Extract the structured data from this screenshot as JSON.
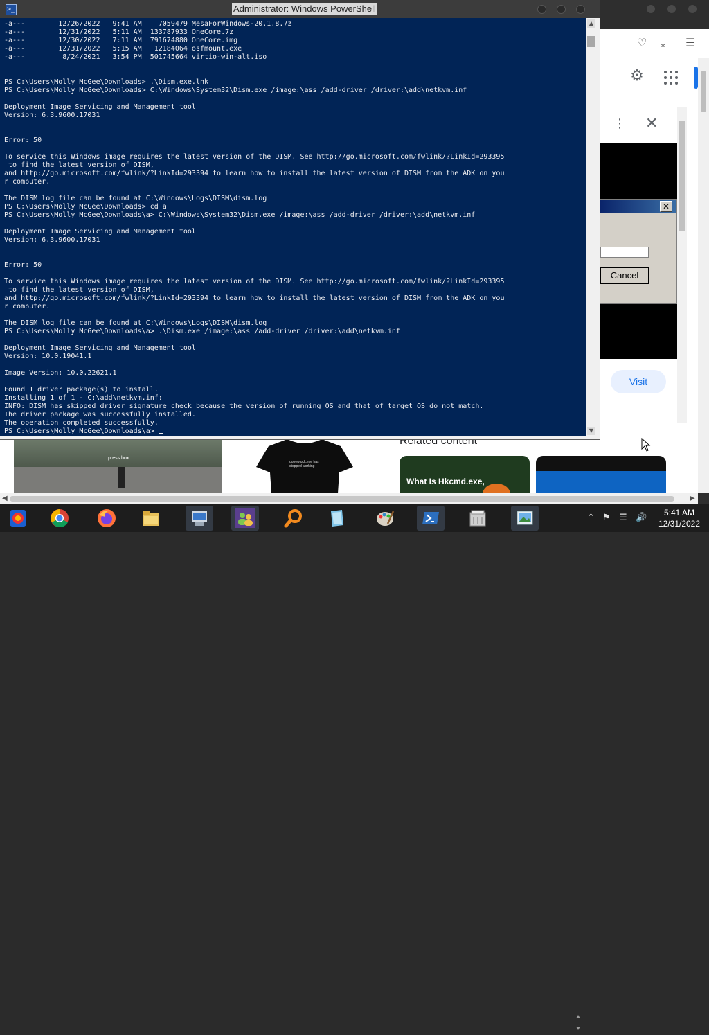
{
  "powershell": {
    "title": "Administrator: Windows PowerShell",
    "icon_glyph": ">_",
    "lines": [
      "-a---        12/26/2022   9:41 AM    7059479 MesaForWindows-20.1.8.7z",
      "-a---        12/31/2022   5:11 AM  133787933 OneCore.7z",
      "-a---        12/30/2022   7:11 AM  791674880 OneCore.img",
      "-a---        12/31/2022   5:15 AM   12184064 osfmount.exe",
      "-a---         8/24/2021   3:54 PM  501745664 virtio-win-alt.iso",
      "",
      "",
      "PS C:\\Users\\Molly McGee\\Downloads> .\\Dism.exe.lnk",
      "PS C:\\Users\\Molly McGee\\Downloads> C:\\Windows\\System32\\Dism.exe /image:\\ass /add-driver /driver:\\add\\netkvm.inf",
      "",
      "Deployment Image Servicing and Management tool",
      "Version: 6.3.9600.17031",
      "",
      "",
      "Error: 50",
      "",
      "To service this Windows image requires the latest version of the DISM. See http://go.microsoft.com/fwlink/?LinkId=293395",
      " to find the latest version of DISM,",
      "and http://go.microsoft.com/fwlink/?LinkId=293394 to learn how to install the latest version of DISM from the ADK on you",
      "r computer.",
      "",
      "The DISM log file can be found at C:\\Windows\\Logs\\DISM\\dism.log",
      "PS C:\\Users\\Molly McGee\\Downloads> cd a",
      "PS C:\\Users\\Molly McGee\\Downloads\\a> C:\\Windows\\System32\\Dism.exe /image:\\ass /add-driver /driver:\\add\\netkvm.inf",
      "",
      "Deployment Image Servicing and Management tool",
      "Version: 6.3.9600.17031",
      "",
      "",
      "Error: 50",
      "",
      "To service this Windows image requires the latest version of the DISM. See http://go.microsoft.com/fwlink/?LinkId=293395",
      " to find the latest version of DISM,",
      "and http://go.microsoft.com/fwlink/?LinkId=293394 to learn how to install the latest version of DISM from the ADK on you",
      "r computer.",
      "",
      "The DISM log file can be found at C:\\Windows\\Logs\\DISM\\dism.log",
      "PS C:\\Users\\Molly McGee\\Downloads\\a> .\\Dism.exe /image:\\ass /add-driver /driver:\\add\\netkvm.inf",
      "",
      "Deployment Image Servicing and Management tool",
      "Version: 10.0.19041.1",
      "",
      "Image Version: 10.0.22621.1",
      "",
      "Found 1 driver package(s) to install.",
      "Installing 1 of 1 - C:\\add\\netkvm.inf:",
      "INFO: DISM has skipped driver signature check because the version of running OS and that of target OS do not match.",
      "The driver package was successfully installed.",
      "The operation completed successfully."
    ],
    "prompt": "PS C:\\Users\\Molly McGee\\Downloads\\a> "
  },
  "background_browser": {
    "dialog_cancel_label": "Cancel",
    "visit_button_label": "Visit",
    "related_heading": "Related content",
    "card1_title": "What Is Hkcmd.exe,",
    "shirt_text": "gonewluck.exe has stopped working",
    "video_overlay": "press box"
  },
  "taskbar": {
    "apps": [
      "chrome-remote-app",
      "google-chrome",
      "firefox",
      "file-explorer",
      "remote-desktop",
      "network-users",
      "search-magnifier",
      "notepad",
      "paint",
      "powershell",
      "file-cabinet",
      "image-viewer"
    ],
    "time": "5:41 AM",
    "date": "12/31/2022"
  },
  "colors": {
    "console_bg": "#012456",
    "console_fg": "#eeedf0",
    "accent": "#1a73e8"
  }
}
